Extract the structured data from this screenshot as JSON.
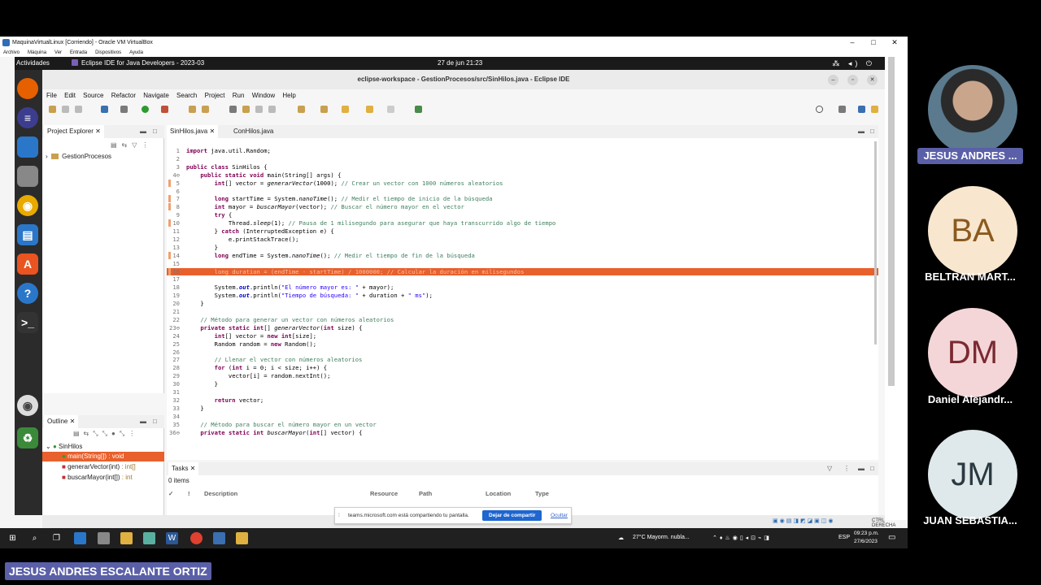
{
  "vbox": {
    "title": "MaquinaVirtualLinux [Corriendo] - Oracle VM VirtualBox",
    "menu": [
      "Archivo",
      "Máquina",
      "Ver",
      "Entrada",
      "Dispositivos",
      "Ayuda"
    ],
    "min": "–",
    "max": "□",
    "close": "✕"
  },
  "gnome": {
    "activities": "Actividades",
    "app": "Eclipse IDE for Java Developers - 2023-03",
    "clock": "27 de jun  21:23",
    "tray": "⁂ ◂) ⏻"
  },
  "eclipse": {
    "title": "eclipse-workspace - GestionProcesos/src/SinHilos.java - Eclipse IDE",
    "menu": [
      "File",
      "Edit",
      "Source",
      "Refactor",
      "Navigate",
      "Search",
      "Project",
      "Run",
      "Window",
      "Help"
    ],
    "project_explorer": {
      "tab": "Project Explorer",
      "project": "GestionProcesos"
    },
    "editor_tabs": [
      "SinHilos.java",
      "ConHilos.java"
    ],
    "outline": {
      "tab": "Outline",
      "class": "SinHilos",
      "items": [
        {
          "name": "main(String[])",
          "type": ": void"
        },
        {
          "name": "generarVector(int)",
          "type": ": int[]"
        },
        {
          "name": "buscarMayor(int[])",
          "type": ": int"
        }
      ]
    },
    "tasks": {
      "tab": "Tasks",
      "count": "0 items",
      "columns": [
        "Description",
        "Resource",
        "Path",
        "Location",
        "Type"
      ]
    },
    "code_lines": [
      {
        "n": "1",
        "text": "import java.util.Random;"
      },
      {
        "n": "2",
        "text": ""
      },
      {
        "n": "3",
        "text": "public class SinHilos {"
      },
      {
        "n": "4⊖",
        "text": "    public static void main(String[] args) {"
      },
      {
        "n": "5",
        "text": "        int[] vector = generarVector(1000); // Crear un vector con 1000 números aleatorios"
      },
      {
        "n": "6",
        "text": ""
      },
      {
        "n": "7",
        "text": "        long startTime = System.nanoTime(); // Medir el tiempo de inicio de la búsqueda"
      },
      {
        "n": "8",
        "text": "        int mayor = buscarMayor(vector); // Buscar el número mayor en el vector"
      },
      {
        "n": "9",
        "text": "        try {"
      },
      {
        "n": "10",
        "text": "            Thread.sleep(1); // Pausa de 1 milisegundo para asegurar que haya transcurrido algo de tiempo"
      },
      {
        "n": "11",
        "text": "        } catch (InterruptedException e) {"
      },
      {
        "n": "12",
        "text": "            e.printStackTrace();"
      },
      {
        "n": "13",
        "text": "        }"
      },
      {
        "n": "14",
        "text": "        long endTime = System.nanoTime(); // Medir el tiempo de fin de la búsqueda"
      },
      {
        "n": "15",
        "text": ""
      },
      {
        "n": "16",
        "text": "        long duration = (endTime - startTime) / 1000000; // Calcular la duración en milisegundos"
      },
      {
        "n": "17",
        "text": ""
      },
      {
        "n": "18",
        "text": "        System.out.println(\"El número mayor es: \" + mayor);"
      },
      {
        "n": "19",
        "text": "        System.out.println(\"Tiempo de búsqueda: \" + duration + \" ms\");"
      },
      {
        "n": "20",
        "text": "    }"
      },
      {
        "n": "21",
        "text": ""
      },
      {
        "n": "22",
        "text": "    // Método para generar un vector con números aleatorios"
      },
      {
        "n": "23⊖",
        "text": "    private static int[] generarVector(int size) {"
      },
      {
        "n": "24",
        "text": "        int[] vector = new int[size];"
      },
      {
        "n": "25",
        "text": "        Random random = new Random();"
      },
      {
        "n": "26",
        "text": ""
      },
      {
        "n": "27",
        "text": "        // Llenar el vector con números aleatorios"
      },
      {
        "n": "28",
        "text": "        for (int i = 0; i < size; i++) {"
      },
      {
        "n": "29",
        "text": "            vector[i] = random.nextInt();"
      },
      {
        "n": "30",
        "text": "        }"
      },
      {
        "n": "31",
        "text": ""
      },
      {
        "n": "32",
        "text": "        return vector;"
      },
      {
        "n": "33",
        "text": "    }"
      },
      {
        "n": "34",
        "text": ""
      },
      {
        "n": "35",
        "text": "    // Método para buscar el número mayor en un vector"
      },
      {
        "n": "36⊖",
        "text": "    private static int buscarMayor(int[] vector) {"
      }
    ]
  },
  "share_banner": {
    "text": "teams.microsoft.com está compartiendo tu pantalla.",
    "stop": "Dejar de compartir",
    "hide": "Ocultar"
  },
  "ctrl_label": "CTRL DERECHA",
  "taskbar": {
    "weather": "27°C  Mayorm. nubla...",
    "lang": "ESP",
    "time": "09:23 p.m.",
    "date": "27/6/2023"
  },
  "participants": [
    {
      "name": "JESUS ANDRES ...",
      "initials": ""
    },
    {
      "name": "BELTRAN MART...",
      "initials": "BA"
    },
    {
      "name": "Daniel Alejandr...",
      "initials": "DM"
    },
    {
      "name": "JUAN SEBASTIA...",
      "initials": "JM"
    }
  ],
  "presenter": "JESUS ANDRES ESCALANTE ORTIZ",
  "colors": {
    "highlight": "#e8602c",
    "teams_accent": "#5a5fa8",
    "stop_button": "#1e66d0"
  }
}
